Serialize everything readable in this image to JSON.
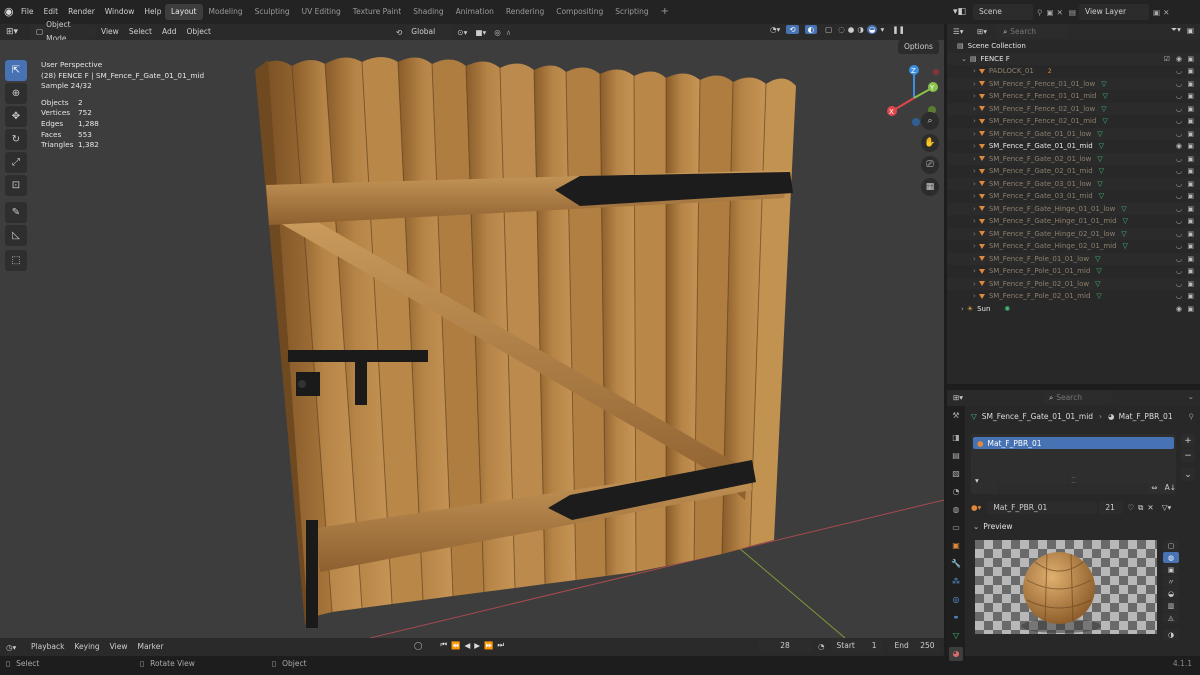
{
  "menu": {
    "items": [
      "File",
      "Edit",
      "Render",
      "Window",
      "Help"
    ]
  },
  "workspaces": [
    "Layout",
    "Modeling",
    "Sculpting",
    "UV Editing",
    "Texture Paint",
    "Shading",
    "Animation",
    "Rendering",
    "Compositing",
    "Scripting"
  ],
  "active_workspace": "Layout",
  "scene": {
    "name": "Scene",
    "view_layer": "View Layer"
  },
  "viewport_header": {
    "mode": "Object Mode",
    "menus": [
      "View",
      "Select",
      "Add",
      "Object"
    ],
    "transform_orientation": "Global",
    "options_label": "Options"
  },
  "overlay": {
    "perspective": "User Perspective",
    "object_line": "(28) FENCE F | SM_Fence_F_Gate_01_01_mid",
    "sample": "Sample 24/32",
    "stats": [
      {
        "label": "Objects",
        "value": "2"
      },
      {
        "label": "Vertices",
        "value": "752"
      },
      {
        "label": "Edges",
        "value": "1,288"
      },
      {
        "label": "Faces",
        "value": "553"
      },
      {
        "label": "Triangles",
        "value": "1,382"
      }
    ]
  },
  "gizmo": {
    "x": "X",
    "y": "Y",
    "z": "Z"
  },
  "outliner": {
    "search_placeholder": "Search",
    "root": "Scene Collection",
    "collection": "FENCE F",
    "items": [
      {
        "name": "PADLOCK_01",
        "badge": "2"
      },
      {
        "name": "SM_Fence_F_Fence_01_01_low"
      },
      {
        "name": "SM_Fence_F_Fence_01_01_mid"
      },
      {
        "name": "SM_Fence_F_Fence_02_01_low"
      },
      {
        "name": "SM_Fence_F_Fence_02_01_mid"
      },
      {
        "name": "SM_Fence_F_Gate_01_01_low"
      },
      {
        "name": "SM_Fence_F_Gate_01_01_mid"
      },
      {
        "name": "SM_Fence_F_Gate_02_01_low"
      },
      {
        "name": "SM_Fence_F_Gate_02_01_mid"
      },
      {
        "name": "SM_Fence_F_Gate_03_01_low"
      },
      {
        "name": "SM_Fence_F_Gate_03_01_mid"
      },
      {
        "name": "SM_Fence_F_Gate_Hinge_01_01_low"
      },
      {
        "name": "SM_Fence_F_Gate_Hinge_01_01_mid"
      },
      {
        "name": "SM_Fence_F_Gate_Hinge_02_01_low"
      },
      {
        "name": "SM_Fence_F_Gate_Hinge_02_01_mid"
      },
      {
        "name": "SM_Fence_F_Pole_01_01_low"
      },
      {
        "name": "SM_Fence_F_Pole_01_01_mid"
      },
      {
        "name": "SM_Fence_F_Pole_02_01_low"
      },
      {
        "name": "SM_Fence_F_Pole_02_01_mid"
      }
    ],
    "active_item": "SM_Fence_F_Gate_01_01_mid",
    "sun": "Sun"
  },
  "properties": {
    "search_placeholder": "Search",
    "breadcrumb_object": "SM_Fence_F_Gate_01_01_mid",
    "breadcrumb_material": "Mat_F_PBR_01",
    "slot": "Mat_F_PBR_01",
    "material_name": "Mat_F_PBR_01",
    "users": "21",
    "preview_label": "Preview"
  },
  "timeline": {
    "menus": [
      "Playback",
      "Keying",
      "View",
      "Marker"
    ],
    "current_frame": "28",
    "start_label": "Start",
    "start": "1",
    "end_label": "End",
    "end": "250"
  },
  "statusbar": {
    "select": "Select",
    "rotate": "Rotate View",
    "object": "Object",
    "version": "4.1.1"
  },
  "colors": {
    "accent": "#4772b3",
    "wood": "#b07a3e",
    "iron": "#1b1b1b",
    "x_axis": "#e0474c",
    "y_axis": "#8bc34a",
    "z_axis": "#3b8ee0"
  }
}
